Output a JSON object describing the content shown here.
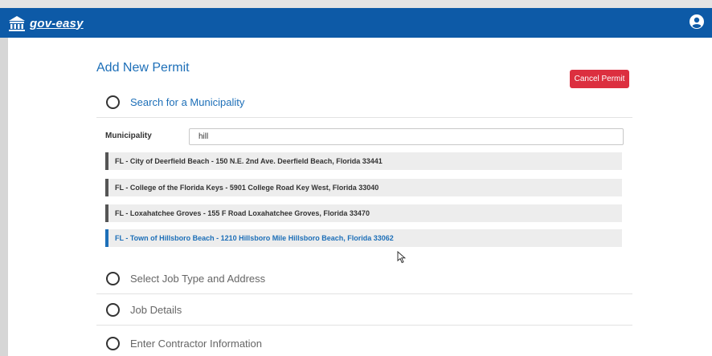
{
  "header": {
    "logo_text": "gov-easy",
    "logo_icon": "capitol-building-icon",
    "user_icon": "user-circle-icon",
    "brand_color": "#0d5aa7"
  },
  "page": {
    "title": "Add New Permit",
    "cancel_label": "Cancel Permit",
    "cancel_color": "#dc2f3f"
  },
  "steps": [
    {
      "label": "Search for a Municipality",
      "active": true
    },
    {
      "label": "Select Job Type and Address",
      "active": false
    },
    {
      "label": "Job Details",
      "active": false
    },
    {
      "label": "Enter Contractor Information",
      "active": false
    }
  ],
  "search": {
    "label": "Municipality",
    "value": "hill"
  },
  "results": [
    {
      "text": "FL - City of Deerfield Beach - 150 N.E. 2nd Ave. Deerfield Beach, Florida 33441",
      "selected": false
    },
    {
      "text": "FL - College of the Florida Keys - 5901 College Road Key West, Florida 33040",
      "selected": false
    },
    {
      "text": "FL - Loxahatchee Groves - 155 F Road Loxahatchee Groves, Florida 33470",
      "selected": false
    },
    {
      "text": "FL - Town of Hillsboro Beach - 1210 Hillsboro Mile Hillsboro Beach, Florida 33062",
      "selected": true
    }
  ]
}
